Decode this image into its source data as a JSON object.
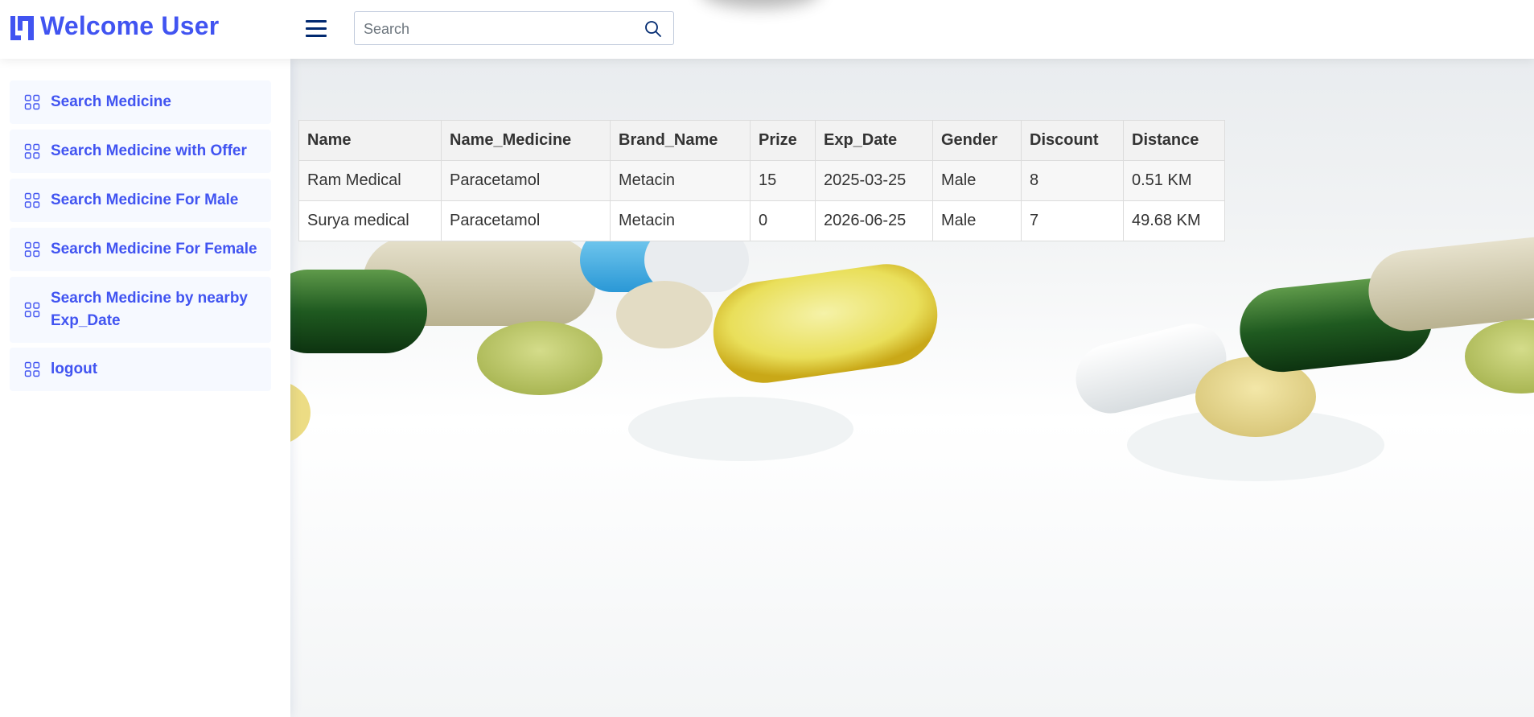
{
  "header": {
    "brand": "Welcome User",
    "search_placeholder": "Search",
    "search_value": ""
  },
  "sidebar": {
    "items": [
      {
        "label": "Search Medicine"
      },
      {
        "label": "Search Medicine with Offer"
      },
      {
        "label": "Search Medicine For Male"
      },
      {
        "label": "Search Medicine For Female"
      },
      {
        "label": "Search Medicine by nearby Exp_Date"
      },
      {
        "label": "logout"
      }
    ]
  },
  "table": {
    "columns": [
      "Name",
      "Name_Medicine",
      "Brand_Name",
      "Prize",
      "Exp_Date",
      "Gender",
      "Discount",
      "Distance"
    ],
    "rows": [
      [
        "Ram Medical",
        "Paracetamol",
        "Metacin",
        "15",
        "2025-03-25",
        "Male",
        "8",
        "0.51 KM"
      ],
      [
        "Surya medical",
        "Paracetamol",
        "Metacin",
        "0",
        "2026-06-25",
        "Male",
        "7",
        "49.68 KM"
      ]
    ]
  },
  "colors": {
    "accent": "#4154f1",
    "navy": "#012970",
    "nav_bg": "#f6f9ff"
  },
  "icons": {
    "logo": "logo-icon",
    "menu": "hamburger-menu-icon",
    "search": "search-icon",
    "nav": "grid-icon"
  }
}
